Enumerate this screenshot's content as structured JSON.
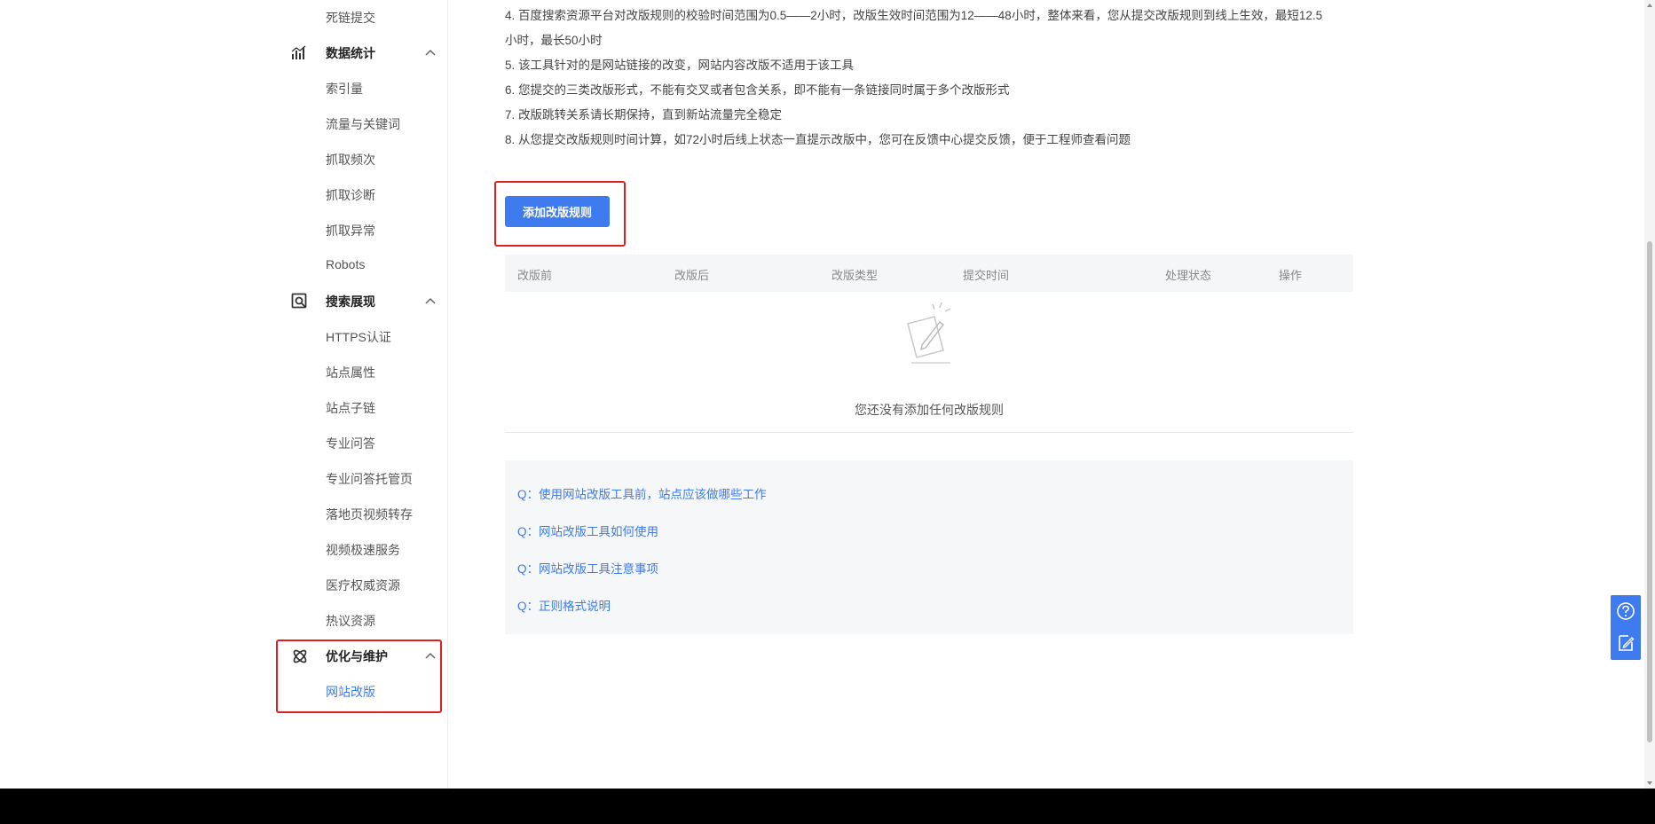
{
  "sidebar": {
    "top_item": "死链提交",
    "groups": [
      {
        "label": "数据统计",
        "icon": "bar-chart-icon",
        "items": [
          "索引量",
          "流量与关键词",
          "抓取频次",
          "抓取诊断",
          "抓取异常",
          "Robots"
        ]
      },
      {
        "label": "搜索展现",
        "icon": "search-display-icon",
        "items": [
          "HTTPS认证",
          "站点属性",
          "站点子链",
          "专业问答",
          "专业问答托管页",
          "落地页视频转存",
          "视频极速服务",
          "医疗权威资源",
          "热议资源"
        ]
      },
      {
        "label": "优化与维护",
        "icon": "atom-icon",
        "items": [
          "网站改版"
        ]
      }
    ]
  },
  "notes": [
    "4. 百度搜索资源平台对改版规则的校验时间范围为0.5——2小时，改版生效时间范围为12——48小时，整体来看，您从提交改版规则到线上生效，最短12.5",
    "小时，最长50小时",
    "5. 该工具针对的是网站链接的改变，网站内容改版不适用于该工具",
    "6. 您提交的三类改版形式，不能有交叉或者包含关系，即不能有一条链接同时属于多个改版形式",
    "7. 改版跳转关系请长期保持，直到新站流量完全稳定",
    "8. 从您提交改版规则时间计算，如72小时后线上状态一直提示改版中，您可在反馈中心提交反馈，便于工程师查看问题"
  ],
  "add_button_label": "添加改版规则",
  "table": {
    "columns": [
      "改版前",
      "改版后",
      "改版类型",
      "提交时间",
      "处理状态",
      "操作"
    ],
    "empty_text": "您还没有添加任何改版规则"
  },
  "faq": [
    "Q：使用网站改版工具前，站点应该做哪些工作",
    "Q：网站改版工具如何使用",
    "Q：网站改版工具注意事项",
    "Q：正则格式说明"
  ],
  "colors": {
    "accent": "#3e7bef",
    "highlight": "#e02020",
    "footer": "#000000"
  }
}
